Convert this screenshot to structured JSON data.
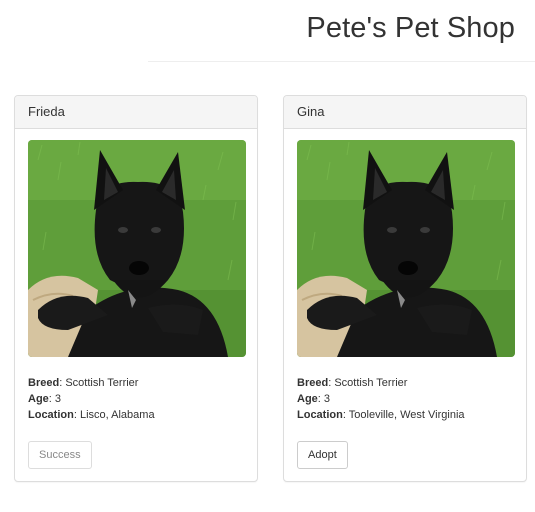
{
  "header": {
    "title": "Pete's Pet Shop"
  },
  "colors": {
    "text": "#333333",
    "panel_heading_bg": "#f5f5f5",
    "panel_border": "#dddddd",
    "grass": "#5f9e3a",
    "dog_fur": "#161616"
  },
  "pets": [
    {
      "name": "Frieda",
      "photo": "scottish-terrier-photo",
      "breed_label": "Breed",
      "breed": "Scottish Terrier",
      "age_label": "Age",
      "age": "3",
      "location_label": "Location",
      "location": "Lisco, Alabama",
      "button_label": "Success",
      "button_state": "disabled"
    },
    {
      "name": "Gina",
      "photo": "scottish-terrier-photo",
      "breed_label": "Breed",
      "breed": "Scottish Terrier",
      "age_label": "Age",
      "age": "3",
      "location_label": "Location",
      "location": "Tooleville, West Virginia",
      "button_label": "Adopt",
      "button_state": "enabled"
    }
  ]
}
